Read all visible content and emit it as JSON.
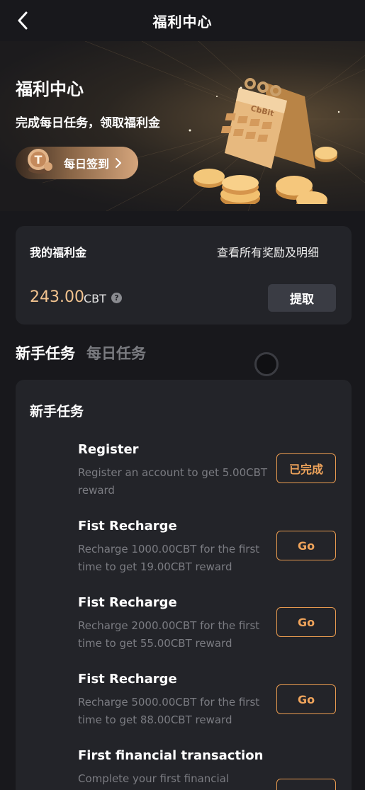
{
  "header": {
    "title": "福利中心"
  },
  "hero": {
    "title": "福利中心",
    "subtitle": "完成每日任务，领取福利金",
    "checkin_label": "每日签到",
    "brand_text": "CbBit"
  },
  "balance": {
    "label": "我的福利金",
    "link": "查看所有奖励及明细",
    "amount": "243.00",
    "unit": "CBT",
    "withdraw_label": "提取"
  },
  "tabs": {
    "active": "新手任务",
    "inactive": "每日任务"
  },
  "tasks": {
    "section_title": "新手任务",
    "items": [
      {
        "name": "Register",
        "desc": "Register an account to get 5.00CBT reward",
        "button": "已完成"
      },
      {
        "name": "Fist Recharge",
        "desc": "Recharge 1000.00CBT for the first time to get 19.00CBT reward",
        "button": "Go"
      },
      {
        "name": "Fist Recharge",
        "desc": "Recharge 2000.00CBT for the first time to get 55.00CBT reward",
        "button": "Go"
      },
      {
        "name": "Fist Recharge",
        "desc": "Recharge 5000.00CBT for the first time to get 88.00CBT reward",
        "button": "Go"
      },
      {
        "name": "First financial transaction",
        "desc": "Complete your first financial",
        "button": ""
      }
    ]
  },
  "colors": {
    "background": "#18181c",
    "card": "#232429",
    "accent": "#f0a45b",
    "amount": "#f2c38f"
  }
}
